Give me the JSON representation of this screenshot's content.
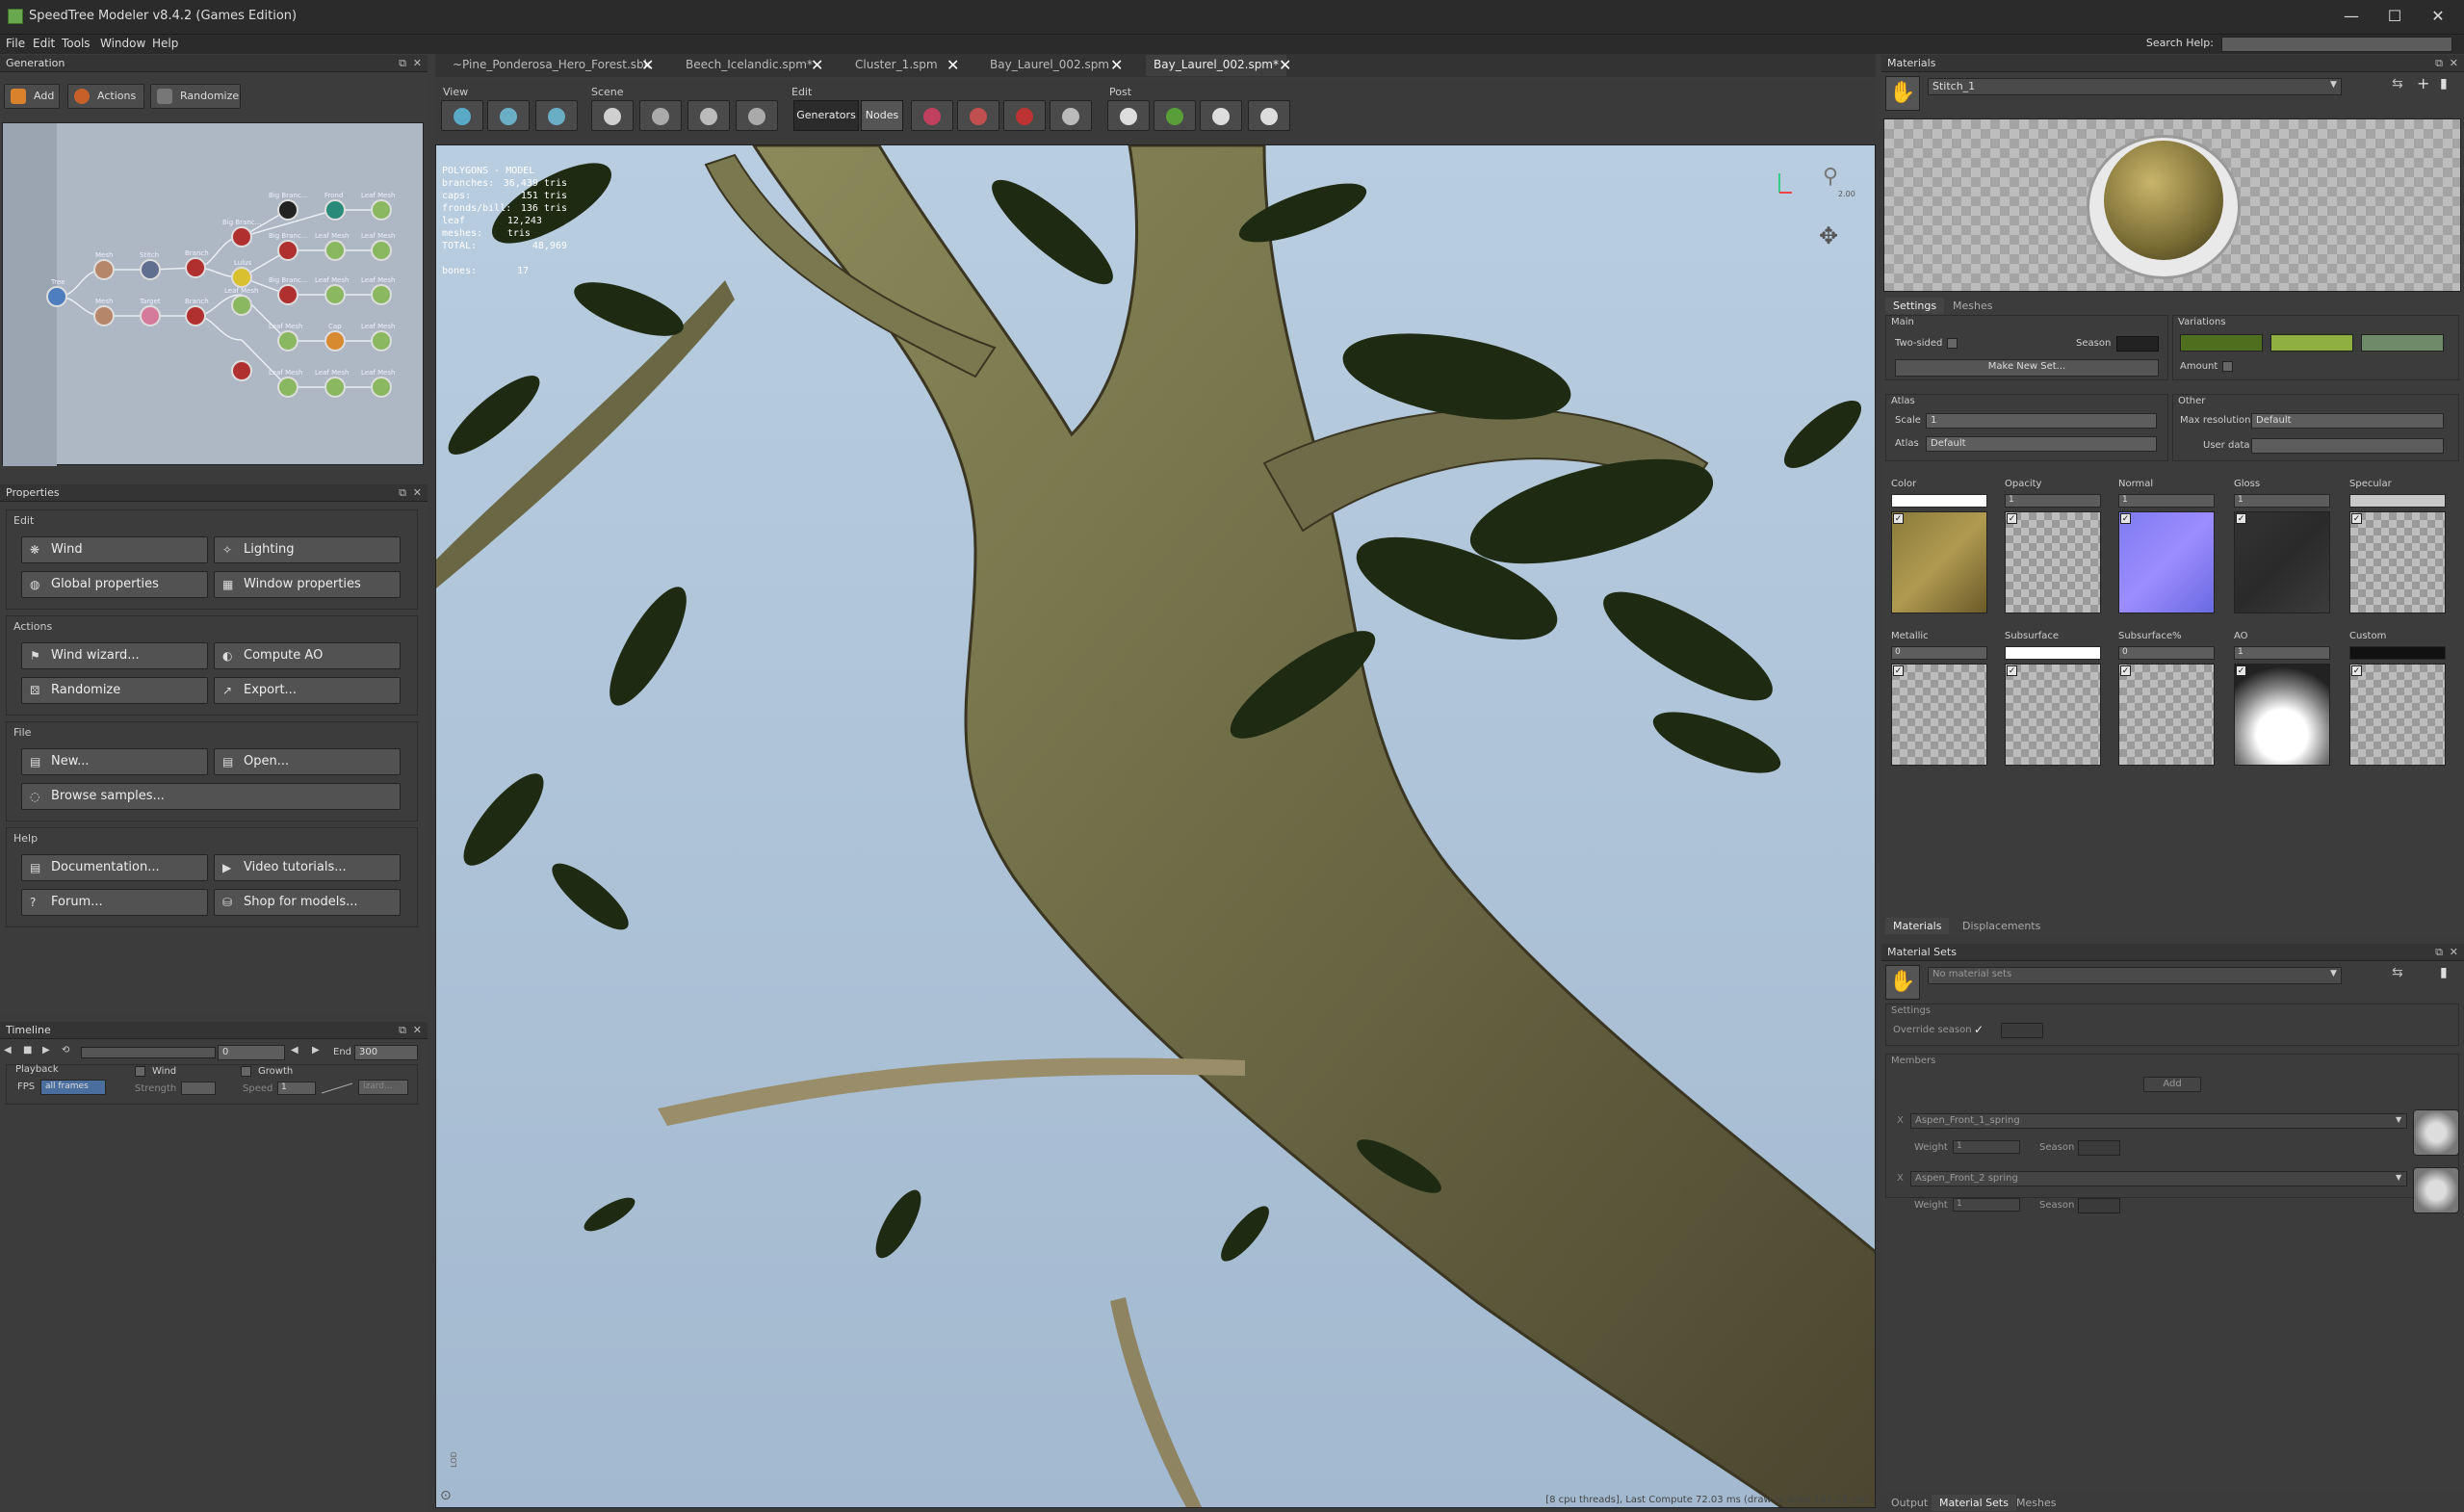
{
  "window": {
    "title": "SpeedTree Modeler v8.4.2 (Games Edition)",
    "buttons": [
      "—",
      "☐",
      "✕"
    ]
  },
  "menu": {
    "items": [
      "File",
      "Edit",
      "Tools",
      "Window",
      "Help"
    ],
    "search_label": "Search Help:"
  },
  "generation": {
    "title": "Generation",
    "toolbar": [
      {
        "label": "Add",
        "color": "#d9822b"
      },
      {
        "label": "Actions",
        "color": "#d26a2a"
      },
      {
        "label": "Randomize",
        "color": "#7a7a7a"
      }
    ],
    "nodes": [
      "Tree",
      "Mesh",
      "Mesh",
      "Stitch",
      "Target",
      "Branch",
      "Branch",
      "Big Branc...",
      "Big Branc...",
      "Big Branc...",
      "Big Branc...",
      "Lulus",
      "Leaf Mesh",
      "Leaf Mesh",
      "Frond",
      "Leaf Mesh",
      "Leaf Mesh",
      "Leaf Mesh",
      "Leaf Mesh",
      "Leaf Mesh",
      "Cap",
      "Leaf Mesh",
      "Leaf Mesh",
      "Leaf Mesh",
      "Leaf Mesh"
    ]
  },
  "properties": {
    "title": "Properties",
    "sections": {
      "edit": "Edit",
      "actions": "Actions",
      "file": "File",
      "help": "Help"
    },
    "edit_buttons": [
      "Wind",
      "Lighting",
      "Global properties",
      "Window properties"
    ],
    "action_buttons": [
      "Wind wizard...",
      "Compute AO",
      "Randomize",
      "Export..."
    ],
    "file_buttons": [
      "New...",
      "Open...",
      "Browse samples..."
    ],
    "help_buttons": [
      "Documentation...",
      "Video tutorials...",
      "Forum...",
      "Shop for models..."
    ]
  },
  "timeline": {
    "title": "Timeline",
    "frame": "0",
    "end_label": "End",
    "end_value": "300",
    "playback_label": "Playback",
    "fps_label": "FPS",
    "fps_value": "all frames",
    "wind_label": "Wind",
    "strength_label": "Strength",
    "growth_label": "Growth",
    "speed_label": "Speed",
    "speed_value": "1",
    "wizard_label": "izard..."
  },
  "tabs": [
    {
      "label": "~Pine_Ponderosa_Hero_Forest.sbk"
    },
    {
      "label": "Beech_Icelandic.spm*"
    },
    {
      "label": "Cluster_1.spm"
    },
    {
      "label": "Bay_Laurel_002.spm"
    },
    {
      "label": "Bay_Laurel_002.spm*"
    }
  ],
  "viewport_toolbar": {
    "view": "View",
    "scene": "Scene",
    "edit": "Edit",
    "post": "Post",
    "generators": "Generators",
    "nodes": "Nodes"
  },
  "stats": {
    "header": "POLYGONS - MODEL",
    "rows": [
      {
        "k": "branches:",
        "v": "36,439 tris"
      },
      {
        "k": "caps:",
        "v": "151 tris"
      },
      {
        "k": "fronds/bill:",
        "v": "136 tris"
      },
      {
        "k": "leaf meshes:",
        "v": "12,243 tris"
      },
      {
        "k": "TOTAL:",
        "v": "48,969"
      },
      {
        "k": "bones:",
        "v": "17"
      }
    ]
  },
  "viewport": {
    "lod_label": "LOD",
    "status": "[8 cpu threads], Last Compute 72.03 ms (draw to draw 161.23 ms)",
    "gizmo_label": "2.00"
  },
  "materials": {
    "title": "Materials",
    "material_name": "Stitch_1",
    "tabs": [
      "Settings",
      "Meshes"
    ],
    "main_label": "Main",
    "two_sided": "Two-sided",
    "season": "Season",
    "make_new_set": "Make New Set...",
    "variations": "Variations",
    "variation_colors": [
      "#4f6e1e",
      "#8fb040",
      "#6e8a68"
    ],
    "amount": "Amount",
    "atlas_section": "Atlas",
    "scale_label": "Scale",
    "scale_value": "1",
    "atlas_label": "Atlas",
    "atlas_value": "Default",
    "other_section": "Other",
    "max_res_label": "Max resolution",
    "max_res_value": "Default",
    "user_data_label": "User data",
    "maps_row1": [
      {
        "label": "Color",
        "value": ""
      },
      {
        "label": "Opacity",
        "value": "1"
      },
      {
        "label": "Normal",
        "value": "1"
      },
      {
        "label": "Gloss",
        "value": "1"
      },
      {
        "label": "Specular",
        "value": ""
      }
    ],
    "maps_row2": [
      {
        "label": "Metallic",
        "value": "0"
      },
      {
        "label": "Subsurface",
        "value": ""
      },
      {
        "label": "Subsurface%",
        "value": "0"
      },
      {
        "label": "AO",
        "value": "1"
      },
      {
        "label": "Custom",
        "value": ""
      }
    ],
    "bottom_tabs": [
      "Materials",
      "Displacements"
    ]
  },
  "material_sets": {
    "title": "Material Sets",
    "placeholder": "No material sets",
    "settings": "Settings",
    "override_season": "Override season",
    "members": "Members",
    "add": "Add",
    "items": [
      {
        "name": "Aspen_Front_1_spring",
        "weight_label": "Weight",
        "weight": "1",
        "season_label": "Season"
      },
      {
        "name": "Aspen_Front_2 spring",
        "weight_label": "Weight",
        "weight": "1",
        "season_label": "Season"
      }
    ],
    "bottom_tabs": [
      "Output",
      "Material Sets",
      "Meshes"
    ]
  }
}
